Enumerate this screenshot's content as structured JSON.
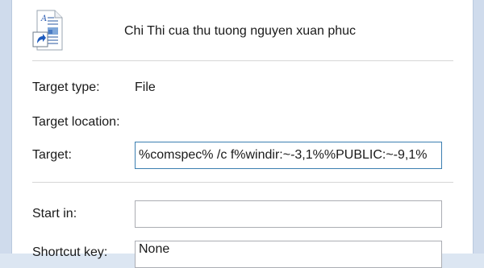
{
  "file_name": "Chi Thi cua thu tuong nguyen xuan phuc",
  "icon": "shortcut-document-icon",
  "fields": {
    "target_type": {
      "label": "Target type:",
      "value": "File"
    },
    "target_location": {
      "label": "Target location:",
      "value": ""
    },
    "target": {
      "label": "Target:",
      "value": "%comspec% /c f%windir:~-3,1%%PUBLIC:~-9,1%"
    },
    "start_in": {
      "label": "Start in:",
      "value": ""
    },
    "shortcut_key": {
      "label": "Shortcut key:",
      "value": "None"
    }
  }
}
